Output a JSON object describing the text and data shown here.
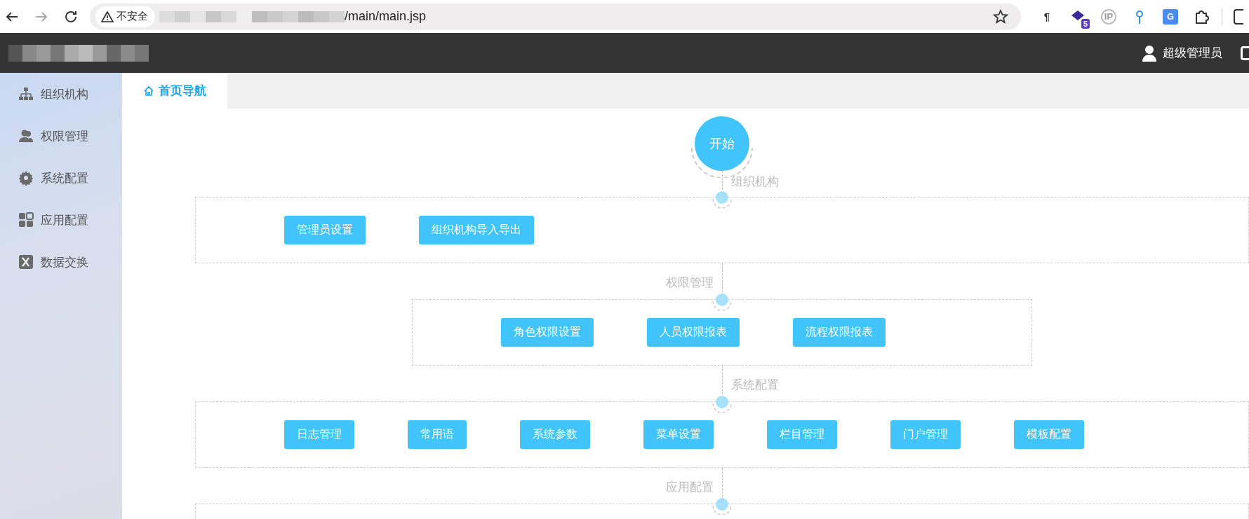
{
  "browser": {
    "back_disabled": false,
    "forward_disabled": true,
    "security_label": "不安全",
    "url_path": "/main/main.jsp",
    "extensions": [
      {
        "kind": "pilcrow",
        "glyph": "¶"
      },
      {
        "kind": "diamond",
        "badge": "5"
      },
      {
        "kind": "ip",
        "glyph": "IP"
      },
      {
        "kind": "pin"
      },
      {
        "kind": "translate",
        "glyph": "G"
      },
      {
        "kind": "puzzle"
      }
    ]
  },
  "header": {
    "user_name": "超级管理员"
  },
  "sidebar": {
    "items": [
      {
        "label": "组织机构",
        "kind": "org"
      },
      {
        "label": "权限管理",
        "kind": "users"
      },
      {
        "label": "系统配置",
        "kind": "gear"
      },
      {
        "label": "应用配置",
        "kind": "grid"
      },
      {
        "label": "数据交换",
        "kind": "x"
      }
    ]
  },
  "tabs": [
    {
      "label": "首页导航",
      "selected": true
    }
  ],
  "flow": {
    "start": "开始",
    "sections": [
      {
        "title": "组织机构",
        "kind": "wide",
        "buttons": [
          "管理员设置",
          "组织机构导入导出"
        ]
      },
      {
        "title": "权限管理",
        "kind": "narrow",
        "buttons": [
          "角色权限设置",
          "人员权限报表",
          "流程权限报表"
        ]
      },
      {
        "title": "系统配置",
        "kind": "wide",
        "buttons": [
          "日志管理",
          "常用语",
          "系统参数",
          "菜单设置",
          "栏目管理",
          "门户管理",
          "模板配置"
        ]
      },
      {
        "title": "应用配置",
        "kind": "wide"
      }
    ]
  }
}
